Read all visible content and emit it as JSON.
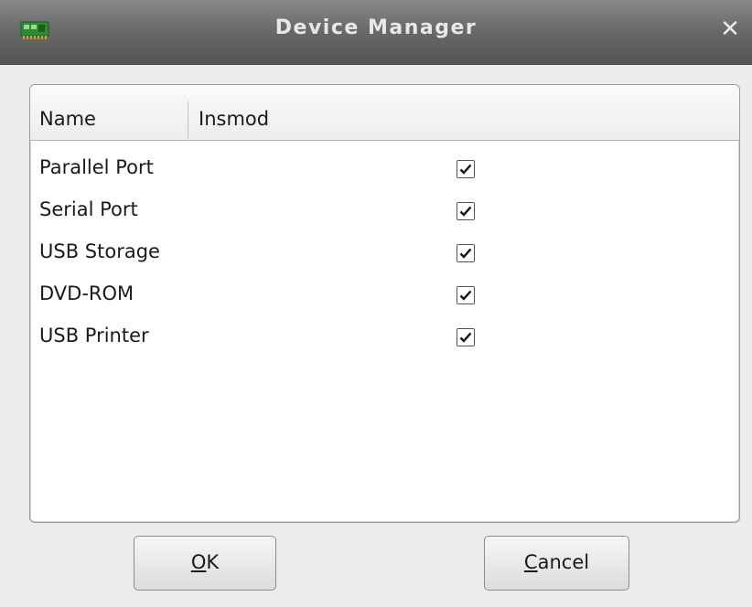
{
  "window": {
    "title": "Device Manager",
    "close_label": "✕"
  },
  "list": {
    "columns": [
      "Name",
      "Insmod"
    ],
    "rows": [
      {
        "name": "Parallel Port",
        "insmod": true
      },
      {
        "name": "Serial Port",
        "insmod": true
      },
      {
        "name": "USB Storage",
        "insmod": true
      },
      {
        "name": "DVD-ROM",
        "insmod": true
      },
      {
        "name": "USB Printer",
        "insmod": true
      }
    ]
  },
  "buttons": {
    "ok": {
      "mnemonic": "O",
      "rest": "K"
    },
    "cancel": {
      "mnemonic": "C",
      "rest": "ancel"
    }
  },
  "colors": {
    "titlebar": "#6a6a6a",
    "background": "#ececec",
    "icon_green": "#2e8b2e"
  },
  "icons": {
    "app": "pci-card-icon",
    "close": "close-icon",
    "check": "checkmark-icon"
  }
}
